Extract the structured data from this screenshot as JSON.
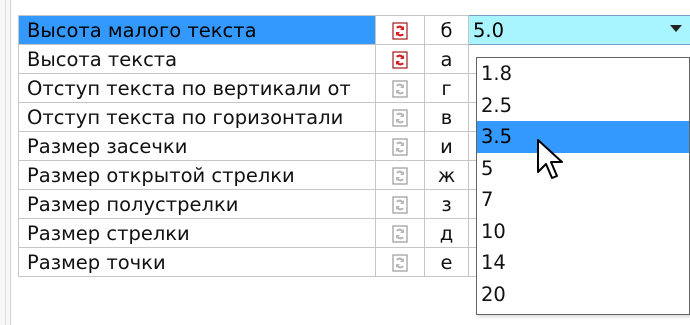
{
  "properties": [
    {
      "name": "Высота малого текста",
      "letter": "б",
      "value": "5.0",
      "selected": true,
      "icon_active": true
    },
    {
      "name": "Высота текста",
      "letter": "а",
      "value": "",
      "selected": false,
      "icon_active": true
    },
    {
      "name": "Отступ текста по вертикали от",
      "letter": "г",
      "value": "",
      "selected": false,
      "icon_active": false
    },
    {
      "name": "Отступ текста по горизонтали",
      "letter": "в",
      "value": "",
      "selected": false,
      "icon_active": false
    },
    {
      "name": "Размер засечки",
      "letter": "и",
      "value": "",
      "selected": false,
      "icon_active": false
    },
    {
      "name": "Размер открытой стрелки",
      "letter": "ж",
      "value": "",
      "selected": false,
      "icon_active": false
    },
    {
      "name": "Размер полустрелки",
      "letter": "з",
      "value": "",
      "selected": false,
      "icon_active": false
    },
    {
      "name": "Размер стрелки",
      "letter": "д",
      "value": "",
      "selected": false,
      "icon_active": false
    },
    {
      "name": "Размер точки",
      "letter": "е",
      "value": "",
      "selected": false,
      "icon_active": false
    }
  ],
  "dropdown": {
    "options": [
      "1.8",
      "2.5",
      "3.5",
      "5",
      "7",
      "10",
      "14",
      "20"
    ],
    "highlighted_index": 2
  },
  "colors": {
    "selection": "#3399ff",
    "value_editor": "#a8f4ff",
    "icon_active": "#d81e1e",
    "icon_inactive": "#b9b9b9"
  },
  "icons": {
    "row_icon": "macro-icon",
    "dropdown_arrow": "chevron-down-icon",
    "cursor": "mouse-pointer-icon"
  }
}
